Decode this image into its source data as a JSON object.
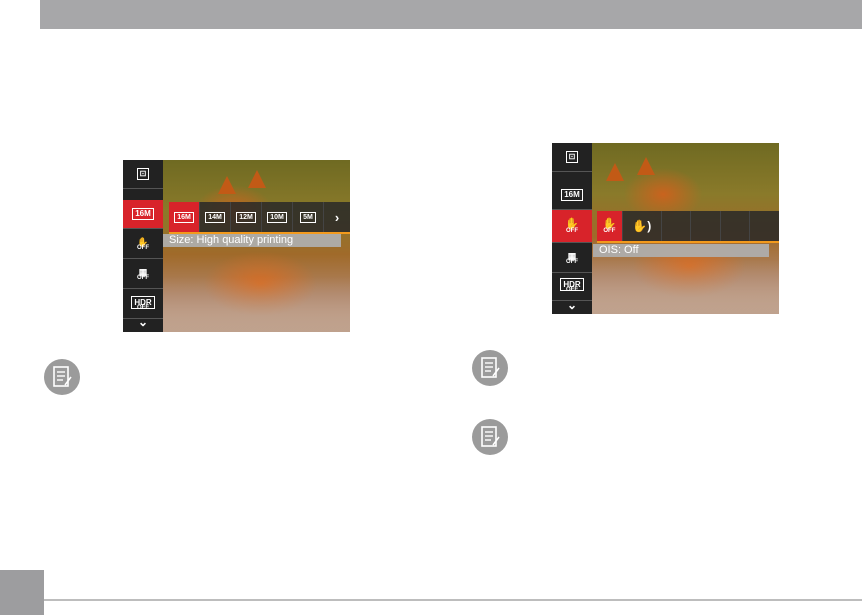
{
  "colors": {
    "header": "#a7a7a9",
    "accent": "#d8232a",
    "highlight": "#f29a1d"
  },
  "left_screen": {
    "menu": [
      {
        "icon": "metering-icon",
        "glyph": "⊡"
      },
      {
        "icon": "image-size-icon",
        "glyph": "16M",
        "active": true
      },
      {
        "icon": "ois-off-icon",
        "glyph": "✋"
      },
      {
        "icon": "continuous-af-off-icon",
        "glyph": "▦"
      },
      {
        "icon": "hdr-off-icon",
        "glyph": "HDR"
      },
      {
        "icon": "chevron-down-icon",
        "glyph": "⌄"
      }
    ],
    "options": [
      "16M",
      "14M",
      "12M",
      "10M",
      "5M"
    ],
    "more_glyph": "›",
    "caption": "Size: High quality printing"
  },
  "right_screen": {
    "menu": [
      {
        "icon": "metering-icon",
        "glyph": "⊡"
      },
      {
        "icon": "image-size-icon",
        "glyph": "16M"
      },
      {
        "icon": "ois-off-icon",
        "glyph": "✋",
        "active": true
      },
      {
        "icon": "continuous-af-off-icon",
        "glyph": "▦"
      },
      {
        "icon": "hdr-off-icon",
        "glyph": "HDR"
      },
      {
        "icon": "chevron-down-icon",
        "glyph": "⌄"
      }
    ],
    "options": [
      "OIS OFF",
      "OIS ON"
    ],
    "caption": "OIS: Off"
  },
  "off_label": "OFF"
}
